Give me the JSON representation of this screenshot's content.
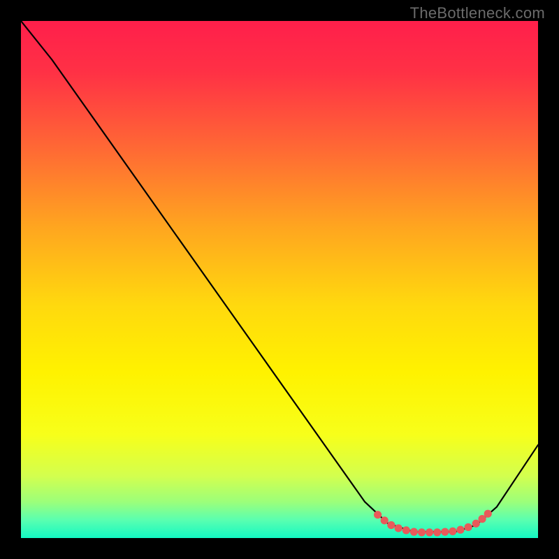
{
  "watermark": "TheBottleneck.com",
  "colors": {
    "bg": "#000000",
    "curve": "#000000",
    "dots": "#e85a5a",
    "gradient_stops": [
      {
        "offset": 0.0,
        "color": "#ff1f4b"
      },
      {
        "offset": 0.1,
        "color": "#ff3145"
      },
      {
        "offset": 0.25,
        "color": "#ff6a34"
      },
      {
        "offset": 0.4,
        "color": "#ffa61f"
      },
      {
        "offset": 0.55,
        "color": "#ffd90e"
      },
      {
        "offset": 0.68,
        "color": "#fff200"
      },
      {
        "offset": 0.8,
        "color": "#f7ff1a"
      },
      {
        "offset": 0.88,
        "color": "#d3ff4e"
      },
      {
        "offset": 0.93,
        "color": "#9cff7a"
      },
      {
        "offset": 0.965,
        "color": "#5affb0"
      },
      {
        "offset": 1.0,
        "color": "#13f8c3"
      }
    ]
  },
  "chart_data": {
    "type": "line",
    "title": "",
    "xlabel": "",
    "ylabel": "",
    "xlim": [
      0,
      100
    ],
    "ylim": [
      0,
      100
    ],
    "grid": false,
    "legend": false,
    "annotations": [
      "TheBottleneck.com"
    ],
    "series": [
      {
        "name": "bottleneck-curve",
        "points": [
          {
            "x": 0.0,
            "y": 100.0
          },
          {
            "x": 6.0,
            "y": 92.5
          },
          {
            "x": 66.5,
            "y": 7.0
          },
          {
            "x": 71.0,
            "y": 2.8
          },
          {
            "x": 76.0,
            "y": 1.2
          },
          {
            "x": 84.0,
            "y": 1.2
          },
          {
            "x": 88.0,
            "y": 2.5
          },
          {
            "x": 92.0,
            "y": 6.0
          },
          {
            "x": 100.0,
            "y": 18.0
          }
        ]
      }
    ],
    "markers": [
      {
        "x": 69.0,
        "y": 4.5
      },
      {
        "x": 70.3,
        "y": 3.4
      },
      {
        "x": 71.6,
        "y": 2.5
      },
      {
        "x": 73.0,
        "y": 1.9
      },
      {
        "x": 74.5,
        "y": 1.5
      },
      {
        "x": 76.0,
        "y": 1.2
      },
      {
        "x": 77.5,
        "y": 1.1
      },
      {
        "x": 79.0,
        "y": 1.1
      },
      {
        "x": 80.5,
        "y": 1.1
      },
      {
        "x": 82.0,
        "y": 1.2
      },
      {
        "x": 83.5,
        "y": 1.3
      },
      {
        "x": 85.0,
        "y": 1.6
      },
      {
        "x": 86.5,
        "y": 2.1
      },
      {
        "x": 88.0,
        "y": 2.8
      },
      {
        "x": 89.2,
        "y": 3.7
      },
      {
        "x": 90.3,
        "y": 4.7
      }
    ]
  }
}
